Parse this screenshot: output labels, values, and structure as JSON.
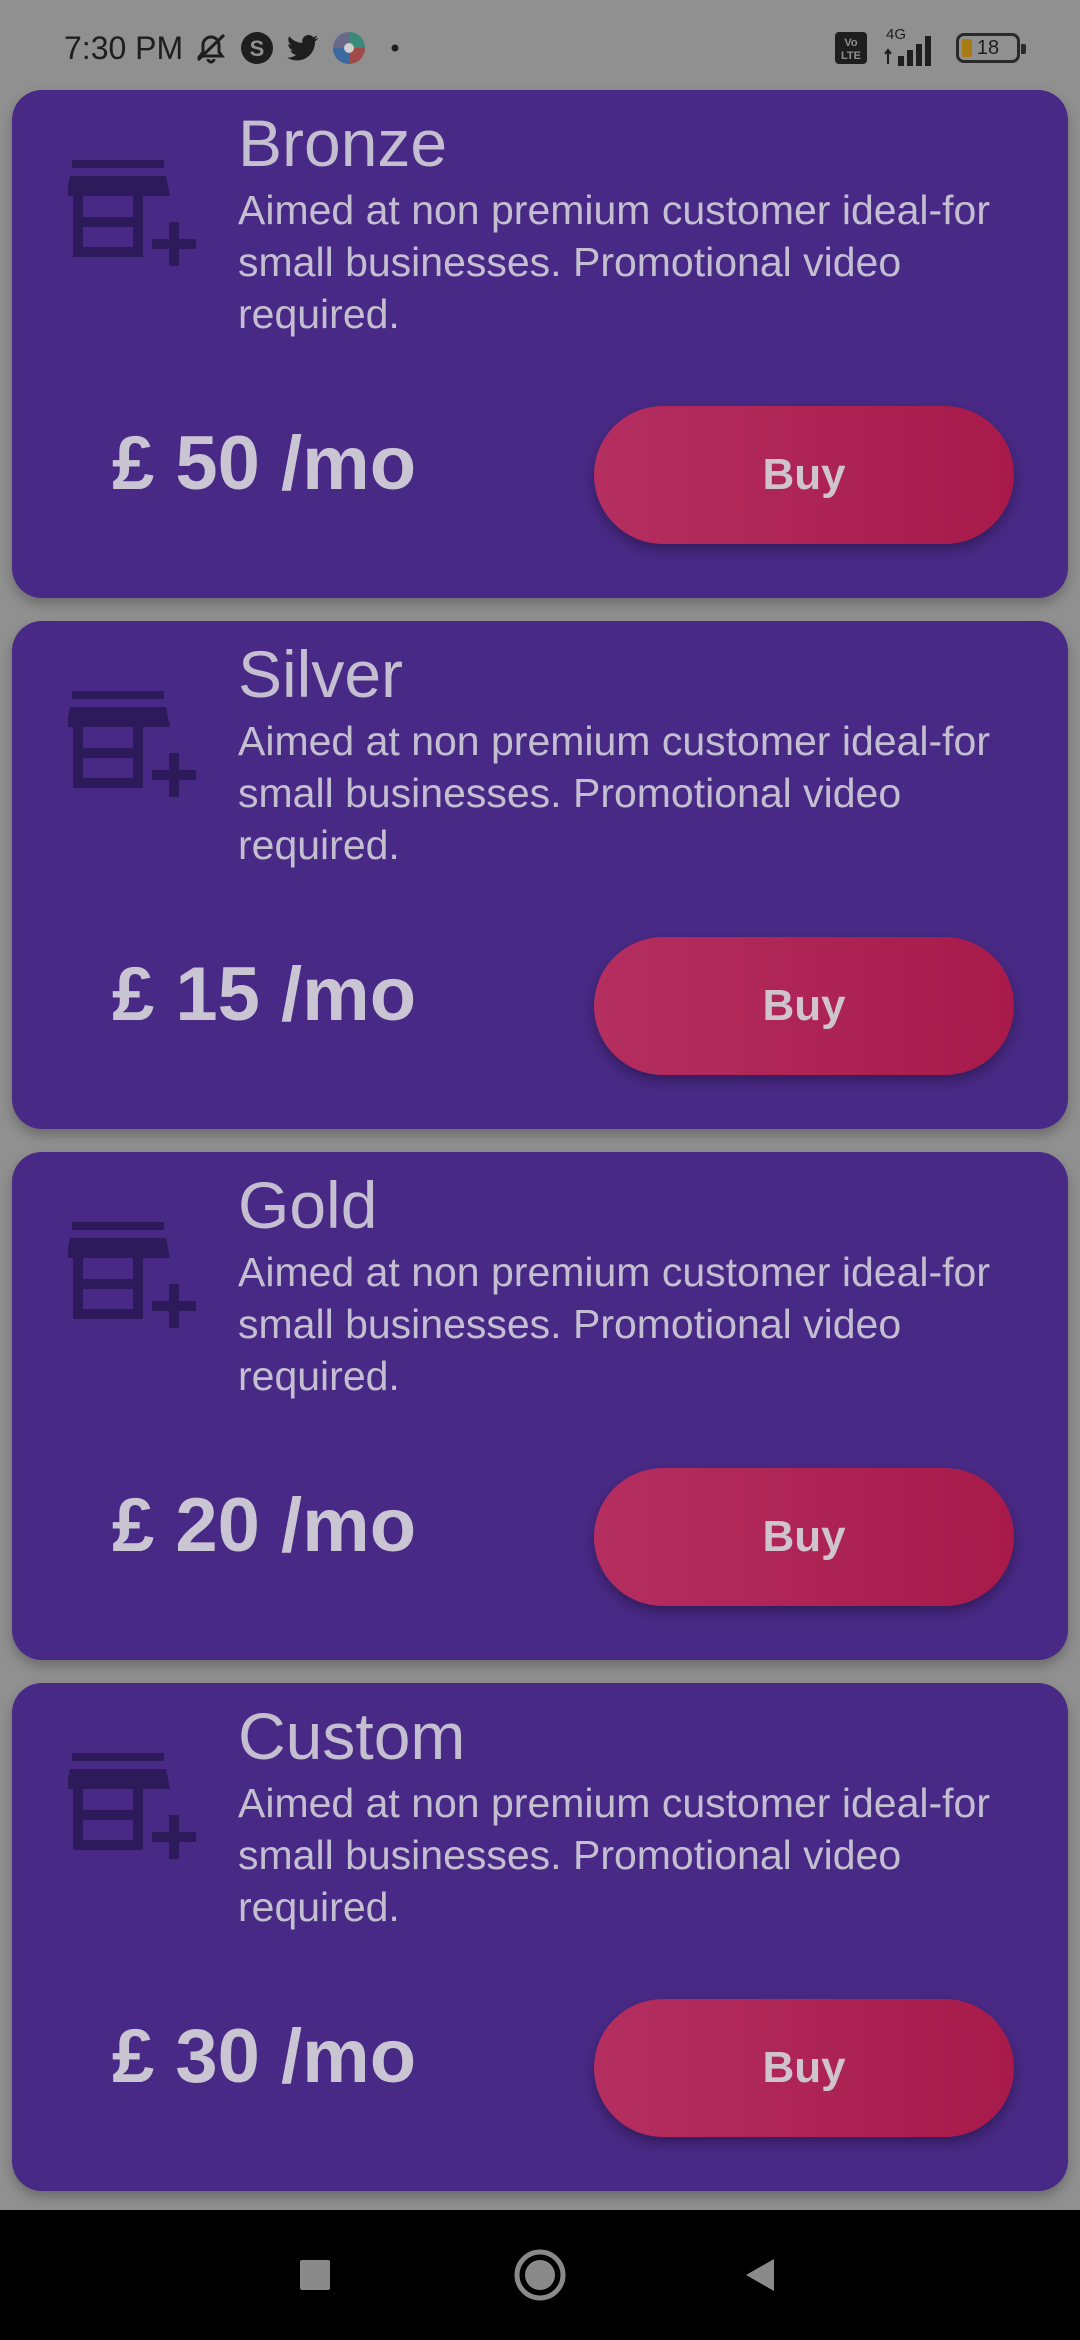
{
  "status_bar": {
    "time": "7:30 PM",
    "network_label": "4G",
    "volte_label": "Vo LTE",
    "battery_level": "18",
    "icons": [
      "mute-alarm-icon",
      "skype-icon",
      "twitter-icon",
      "photos-icon",
      "dot-icon",
      "volte-icon",
      "signal-icon",
      "battery-icon"
    ]
  },
  "plans": [
    {
      "name": "Bronze",
      "description": "Aimed at non premium customer ideal-for small businesses. Promotional video required.",
      "price": "£ 50 /mo",
      "button_label": "Buy",
      "icon": "store-add-icon"
    },
    {
      "name": "Silver",
      "description": "Aimed at non premium customer ideal-for small businesses. Promotional video required.",
      "price": "£ 15 /mo",
      "button_label": "Buy",
      "icon": "store-add-icon"
    },
    {
      "name": "Gold",
      "description": "Aimed at non premium customer ideal-for small businesses. Promotional video required.",
      "price": "£ 20 /mo",
      "button_label": "Buy",
      "icon": "store-add-icon"
    },
    {
      "name": "Custom",
      "description": "Aimed at non premium customer ideal-for small businesses. Promotional video required.",
      "price": "£ 30 /mo",
      "button_label": "Buy",
      "icon": "store-add-icon"
    }
  ],
  "nav_bar": {
    "icons": [
      "recents-square-icon",
      "home-circle-icon",
      "back-triangle-icon"
    ]
  },
  "colors": {
    "card_background": "#482985",
    "button_gradient_start": "#b42e60",
    "button_gradient_end": "#a71a4a",
    "text": "#c4bfd0",
    "screen_background": "#909090"
  }
}
